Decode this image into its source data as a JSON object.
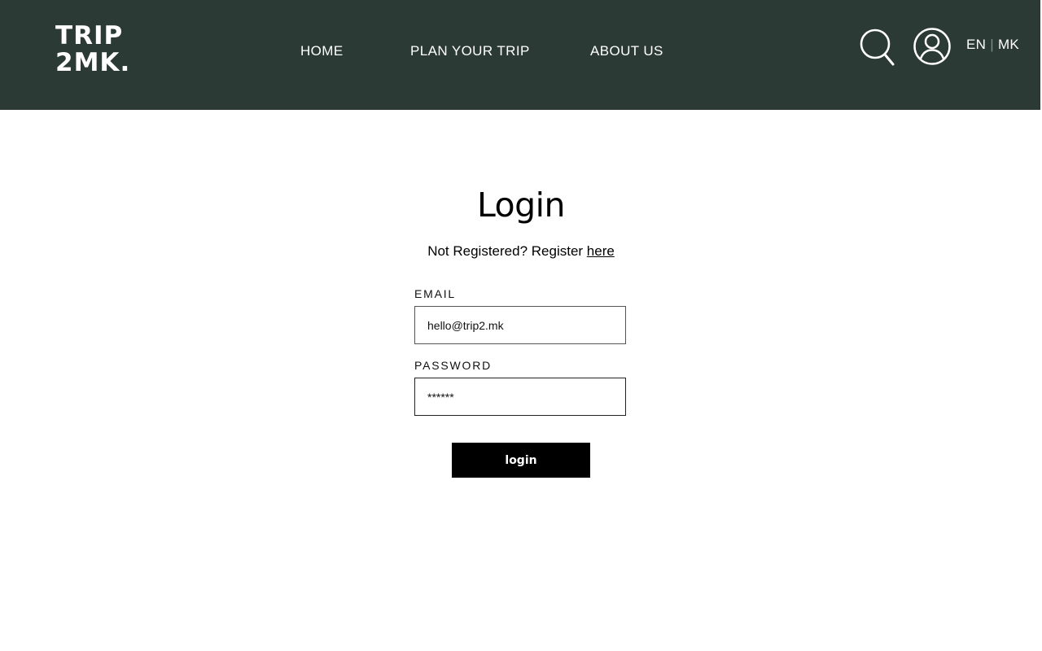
{
  "header": {
    "logo_line1": "TRIP",
    "logo_line2": "2MK.",
    "nav": [
      {
        "label": "HOME"
      },
      {
        "label": "PLAN YOUR TRIP"
      },
      {
        "label": "ABOUT US"
      }
    ],
    "search_icon": "search-icon",
    "user_icon": "user-icon",
    "lang_en": "EN",
    "lang_sep": "|",
    "lang_mk": "MK",
    "background_color": "#2b3a35"
  },
  "login": {
    "title": "Login",
    "subtitle_text": "Not Registered? Register ",
    "register_link": "here",
    "email_label": "EMAIL",
    "email_value": "hello@trip2.mk",
    "password_label": "PASSWORD",
    "password_value": "******",
    "submit_label": "login"
  }
}
